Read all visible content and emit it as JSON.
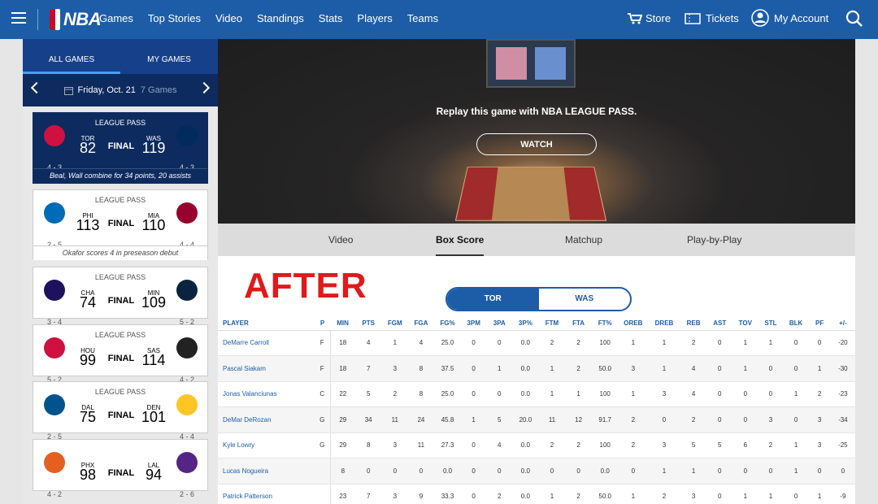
{
  "header": {
    "logo_text": "NBA",
    "nav": [
      "Games",
      "Top Stories",
      "Video",
      "Standings",
      "Stats",
      "Players",
      "Teams"
    ],
    "store": "Store",
    "tickets": "Tickets",
    "account": "My Account"
  },
  "sidebar": {
    "tabs": [
      "ALL GAMES",
      "MY GAMES"
    ],
    "date": "Friday, Oct. 21",
    "games_count": "7 Games",
    "games": [
      {
        "lp": "LEAGUE PASS",
        "away": "TOR",
        "away_score": "82",
        "status": "FINAL",
        "home": "WAS",
        "home_score": "119",
        "away_rec": "4 - 3",
        "home_rec": "4 - 3",
        "caption": "Beal, Wall combine for 34 points, 20 assists",
        "away_color": "#ce1141",
        "home_color": "#002b5c"
      },
      {
        "lp": "LEAGUE PASS",
        "away": "PHI",
        "away_score": "113",
        "status": "FINAL",
        "home": "MIA",
        "home_score": "110",
        "away_rec": "2 - 5",
        "home_rec": "4 - 4",
        "caption": "Okafor scores 4 in preseason debut",
        "away_color": "#006bb6",
        "home_color": "#98002e"
      },
      {
        "lp": "LEAGUE PASS",
        "away": "CHA",
        "away_score": "74",
        "status": "FINAL",
        "home": "MIN",
        "home_score": "109",
        "away_rec": "3 - 4",
        "home_rec": "5 - 2",
        "caption": "",
        "away_color": "#1d1160",
        "home_color": "#0c2340"
      },
      {
        "lp": "LEAGUE PASS",
        "away": "HOU",
        "away_score": "99",
        "status": "FINAL",
        "home": "SAS",
        "home_score": "114",
        "away_rec": "5 - 2",
        "home_rec": "4 - 2",
        "caption": "",
        "away_color": "#ce1141",
        "home_color": "#222222"
      },
      {
        "lp": "LEAGUE PASS",
        "away": "DAL",
        "away_score": "75",
        "status": "FINAL",
        "home": "DEN",
        "home_score": "101",
        "away_rec": "2 - 5",
        "home_rec": "4 - 4",
        "caption": "",
        "away_color": "#00538c",
        "home_color": "#fec524"
      },
      {
        "lp": "",
        "away": "PHX",
        "away_score": "98",
        "status": "FINAL",
        "home": "LAL",
        "home_score": "94",
        "away_rec": "4 - 2",
        "home_rec": "2 - 6",
        "caption": "",
        "away_color": "#e56020",
        "home_color": "#552583"
      }
    ]
  },
  "hero": {
    "replay_text": "Replay this game with NBA LEAGUE PASS.",
    "watch_label": "WATCH"
  },
  "game_tabs": [
    "Video",
    "Box Score",
    "Matchup",
    "Play-by-Play"
  ],
  "overlay_text": "AFTER",
  "team_toggle": [
    "TOR",
    "WAS"
  ],
  "box": {
    "columns": [
      "PLAYER",
      "P",
      "MIN",
      "PTS",
      "FGM",
      "FGA",
      "FG%",
      "3PM",
      "3PA",
      "3P%",
      "FTM",
      "FTA",
      "FT%",
      "OREB",
      "DREB",
      "REB",
      "AST",
      "TOV",
      "STL",
      "BLK",
      "PF",
      "+/-"
    ],
    "rows": [
      [
        "DeMarre Carroll",
        "F",
        "18",
        "4",
        "1",
        "4",
        "25.0",
        "0",
        "0",
        "0.0",
        "2",
        "2",
        "100",
        "1",
        "1",
        "2",
        "0",
        "1",
        "1",
        "0",
        "0",
        "-20"
      ],
      [
        "Pascal Siakam",
        "F",
        "18",
        "7",
        "3",
        "8",
        "37.5",
        "0",
        "1",
        "0.0",
        "1",
        "2",
        "50.0",
        "3",
        "1",
        "4",
        "0",
        "1",
        "0",
        "0",
        "1",
        "-30"
      ],
      [
        "Jonas Valanciunas",
        "C",
        "22",
        "5",
        "2",
        "8",
        "25.0",
        "0",
        "0",
        "0.0",
        "1",
        "1",
        "100",
        "1",
        "3",
        "4",
        "0",
        "0",
        "0",
        "1",
        "2",
        "-23"
      ],
      [
        "DeMar DeRozan",
        "G",
        "29",
        "34",
        "11",
        "24",
        "45.8",
        "1",
        "5",
        "20.0",
        "11",
        "12",
        "91.7",
        "2",
        "0",
        "2",
        "0",
        "0",
        "3",
        "0",
        "3",
        "-34"
      ],
      [
        "Kyle Lowry",
        "G",
        "29",
        "8",
        "3",
        "11",
        "27.3",
        "0",
        "4",
        "0.0",
        "2",
        "2",
        "100",
        "2",
        "3",
        "5",
        "5",
        "6",
        "2",
        "1",
        "3",
        "-25"
      ],
      [
        "Lucas Nogueira",
        "",
        "8",
        "0",
        "0",
        "0",
        "0.0",
        "0",
        "0",
        "0.0",
        "0",
        "0",
        "0.0",
        "0",
        "1",
        "1",
        "0",
        "0",
        "0",
        "1",
        "0",
        "0"
      ],
      [
        "Patrick Patterson",
        "",
        "23",
        "7",
        "3",
        "9",
        "33.3",
        "0",
        "2",
        "0.0",
        "1",
        "2",
        "50.0",
        "1",
        "2",
        "3",
        "0",
        "1",
        "1",
        "0",
        "1",
        "-9"
      ]
    ]
  }
}
